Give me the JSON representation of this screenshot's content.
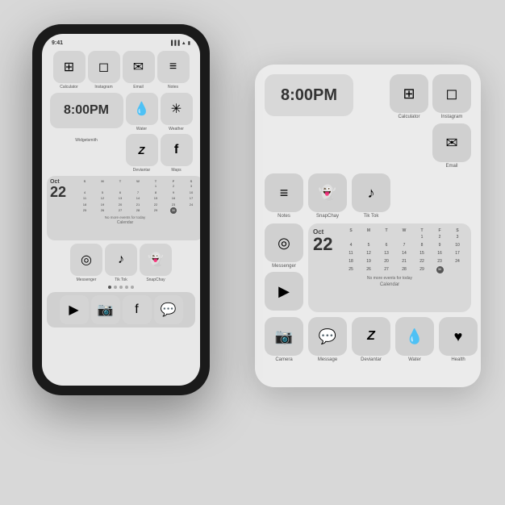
{
  "background_color": "#d8d8d8",
  "phone": {
    "time": "9:41",
    "top_row": {
      "apps": [
        {
          "icon": "⊞",
          "label": "Calculator"
        },
        {
          "icon": "◻",
          "label": "Instagram"
        },
        {
          "icon": "✉",
          "label": "Email"
        },
        {
          "icon": "≡",
          "label": "Notes"
        }
      ]
    },
    "middle_row": {
      "time_widget": "8:00PM",
      "time_widget_label": "Widgetsmith",
      "small_apps": [
        {
          "icon": "💧",
          "label": "Water"
        },
        {
          "icon": "✳",
          "label": "Weather"
        },
        {
          "icon": "Z",
          "label": "Deviantar"
        },
        {
          "icon": "f",
          "label": "Maps"
        }
      ]
    },
    "calendar": {
      "month": "Oct",
      "day": "22",
      "label": "Calendar",
      "no_events": "No more events for today",
      "days_header": [
        "S",
        "M",
        "T",
        "W",
        "T",
        "F",
        "S"
      ],
      "weeks": [
        [
          "",
          "",
          "",
          "",
          "1",
          "2",
          "3"
        ],
        [
          "4",
          "5",
          "6",
          "7",
          "8",
          "9",
          "10"
        ],
        [
          "11",
          "12",
          "13",
          "14",
          "15",
          "16",
          "17"
        ],
        [
          "18",
          "19",
          "20",
          "21",
          "22",
          "23",
          "24"
        ],
        [
          "25",
          "26",
          "27",
          "28",
          "29",
          "30",
          ""
        ]
      ],
      "today": "30"
    },
    "bottom_row1": {
      "apps": [
        {
          "icon": "◎",
          "label": "Messenger"
        },
        {
          "icon": "♪",
          "label": "Tik Tok"
        },
        {
          "icon": "👻",
          "label": "SnapChay"
        }
      ]
    },
    "dots": [
      "active",
      "",
      "",
      "",
      ""
    ],
    "bottom_dock": {
      "apps": [
        {
          "icon": "▶",
          "label": ""
        },
        {
          "icon": "📷",
          "label": ""
        },
        {
          "icon": "f",
          "label": ""
        },
        {
          "icon": "💬",
          "label": ""
        }
      ]
    }
  },
  "panel": {
    "top_row": {
      "time_widget": "8:00PM",
      "apps": [
        {
          "icon": "⊞",
          "label": "Calculator"
        },
        {
          "icon": "◻",
          "label": "Instagram"
        },
        {
          "icon": "✉",
          "label": "Email"
        }
      ]
    },
    "second_row": {
      "apps": [
        {
          "icon": "≡",
          "label": "Notes"
        },
        {
          "icon": "👻",
          "label": "SnapChay"
        },
        {
          "icon": "♪",
          "label": "Tik Tok"
        }
      ]
    },
    "calendar_section": {
      "left_icon": {
        "icon": "◎",
        "label": "Messenger"
      },
      "calendar": {
        "month": "Oct",
        "day": "22",
        "label": "Calendar",
        "no_events": "No more events for today",
        "days_header": [
          "S",
          "M",
          "T",
          "W",
          "T",
          "F",
          "S"
        ],
        "weeks": [
          [
            "",
            "",
            "",
            "",
            "1",
            "2",
            "3"
          ],
          [
            "4",
            "5",
            "6",
            "7",
            "8",
            "9",
            "10"
          ],
          [
            "11",
            "12",
            "13",
            "14",
            "15",
            "16",
            "17"
          ],
          [
            "18",
            "19",
            "20",
            "21",
            "22",
            "23",
            "24"
          ],
          [
            "25",
            "26",
            "27",
            "28",
            "29",
            "30",
            ""
          ]
        ],
        "today": "30"
      },
      "right_icon": {
        "icon": "▶",
        "label": ""
      }
    },
    "bottom_row": {
      "apps": [
        {
          "icon": "📷",
          "label": "Camera"
        },
        {
          "icon": "💬",
          "label": "Message"
        },
        {
          "icon": "Z",
          "label": "Deviantar"
        },
        {
          "icon": "💧",
          "label": "Water"
        },
        {
          "icon": "♥",
          "label": "Health"
        }
      ]
    }
  }
}
